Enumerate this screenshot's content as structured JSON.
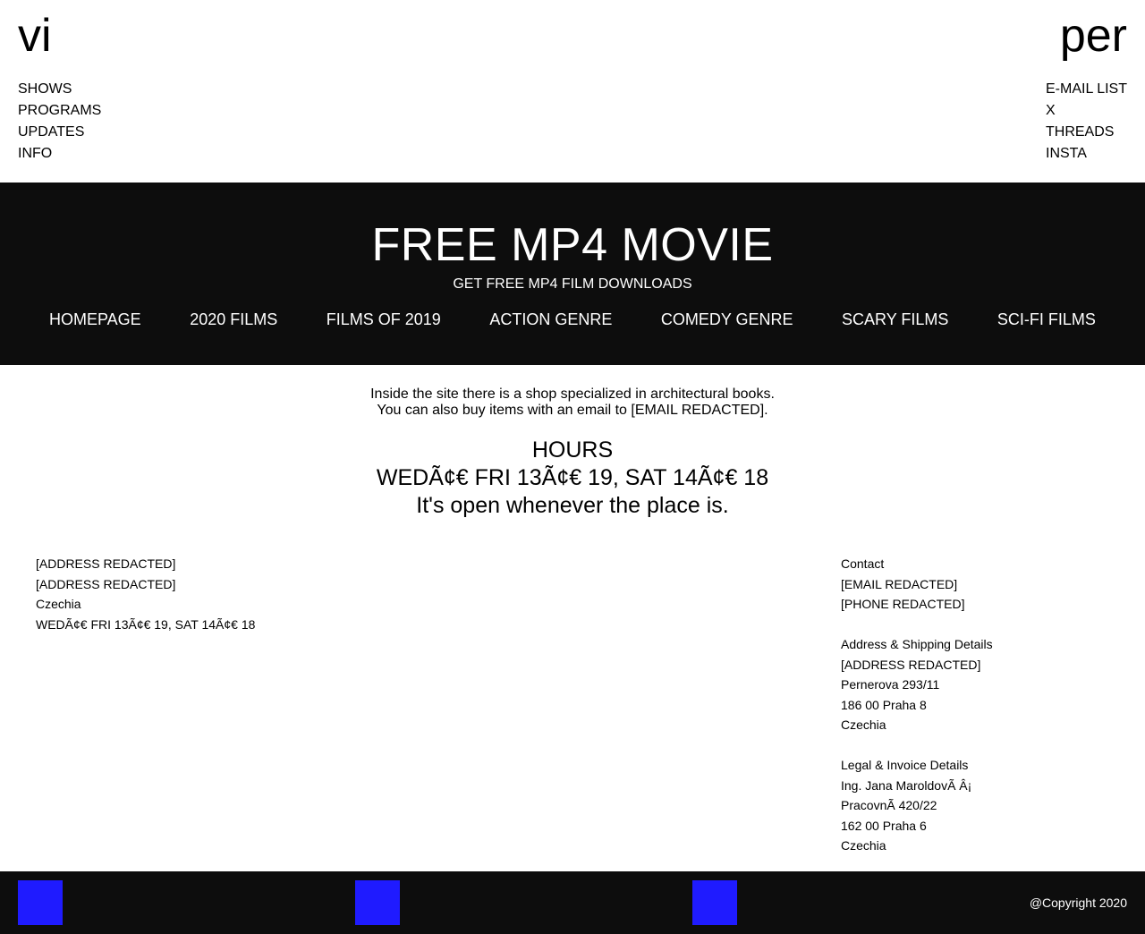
{
  "header": {
    "logo_left": "vi",
    "logo_right": "per",
    "nav_left": [
      "SHOWS",
      "PROGRAMS",
      "UPDATES",
      "INFO"
    ],
    "nav_right": [
      "E-MAIL LIST",
      "X",
      "THREADS",
      "INSTA"
    ]
  },
  "hero": {
    "title": "FREE MP4 MOVIE",
    "subtitle": "GET FREE MP4 FILM DOWNLOADS",
    "menu": [
      "HOMEPAGE",
      "2020 FILMS",
      "FILMS OF 2019",
      "ACTION GENRE",
      "COMEDY GENRE",
      "SCARY FILMS",
      "SCI-FI FILMS"
    ]
  },
  "intro": {
    "line1": "Inside the site there is a shop specialized in architectural books.",
    "line2": "You can also buy items with an email to [EMAIL REDACTED]."
  },
  "hours": {
    "heading": "HOURS",
    "times": "WEDÃ¢€ FRI 13Ã¢€ 19, SAT 14Ã¢€ 18",
    "note": "It's open whenever the place is."
  },
  "info_left": {
    "lines": [
      "[ADDRESS REDACTED]",
      "[ADDRESS REDACTED]",
      "Czechia",
      "WEDÃ¢€ FRI 13Ã¢€ 19, SAT 14Ã¢€ 18"
    ]
  },
  "info_right": {
    "contact": [
      "Contact",
      "[EMAIL REDACTED]",
      "[PHONE REDACTED]"
    ],
    "shipping": [
      "Address & Shipping Details",
      "[ADDRESS REDACTED]",
      "Pernerova 293/11",
      "186 00 Praha 8",
      "Czechia"
    ],
    "legal": [
      "Legal & Invoice Details",
      "Ing. Jana MaroldovÃ Â¡",
      "PracovnÃ 420/22",
      "162 00 Praha 6",
      "Czechia"
    ]
  },
  "footer": {
    "copyright": "@Copyright 2020",
    "square_color": "#1f1bff"
  }
}
